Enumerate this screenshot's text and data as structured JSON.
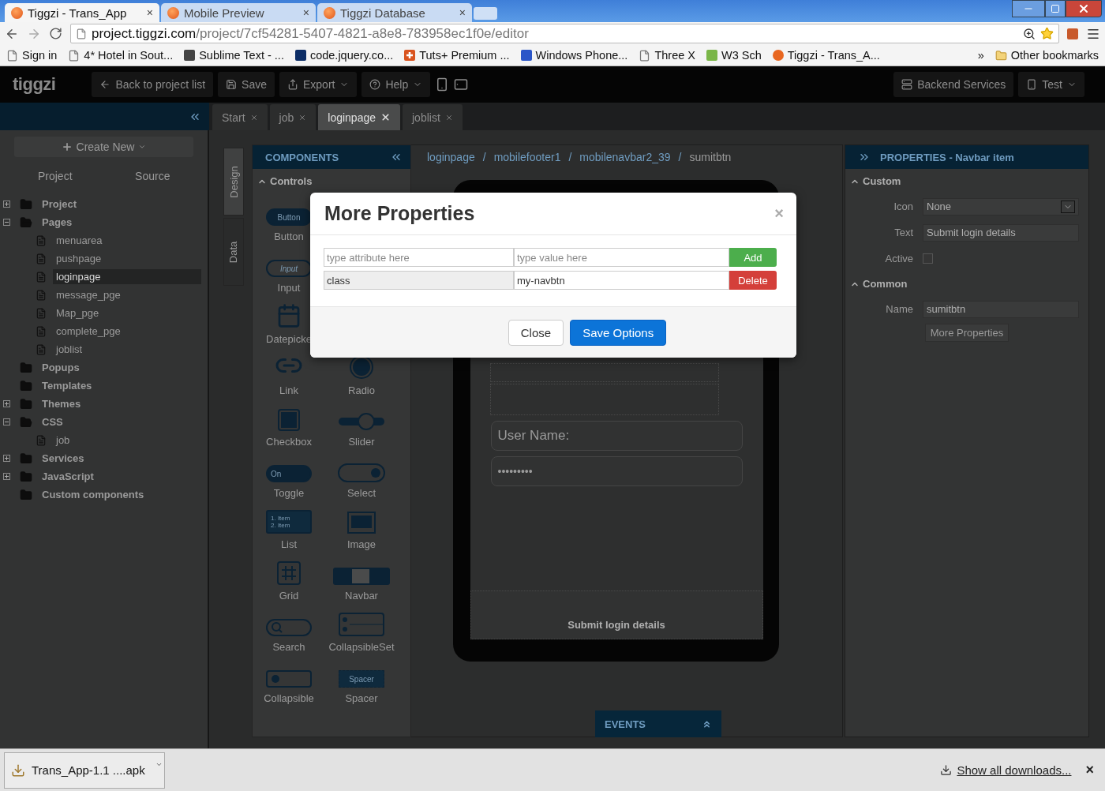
{
  "browser": {
    "tabs": [
      {
        "title": "Tiggzi - Trans_App",
        "selected": true,
        "close": "×"
      },
      {
        "title": "Mobile Preview",
        "selected": false,
        "close": "×"
      },
      {
        "title": "Tiggzi Database",
        "selected": false,
        "close": "×"
      }
    ],
    "address": {
      "host": "project.tiggzi.com",
      "path": "/project/7cf54281-5407-4821-a8e8-783958ec1f0e/editor"
    },
    "bookmarks": [
      {
        "label": "Sign in",
        "kind": "page"
      },
      {
        "label": "4* Hotel in Sout...",
        "kind": "page"
      },
      {
        "label": "Sublime Text - ...",
        "kind": "app"
      },
      {
        "label": "code.jquery.co...",
        "kind": "swirl"
      },
      {
        "label": "Tuts+ Premium ...",
        "kind": "plus"
      },
      {
        "label": "Windows Phone...",
        "kind": "letter"
      },
      {
        "label": "Three X",
        "kind": "page"
      },
      {
        "label": "W3 Sch",
        "kind": "wave"
      },
      {
        "label": "Tiggzi - Trans_A...",
        "kind": "dot"
      }
    ],
    "bookmarks_more": "»",
    "other_bookmarks": "Other bookmarks"
  },
  "toolbar": {
    "logo": "tiggzi",
    "back": "Back to project list",
    "save": "Save",
    "export": "Export",
    "help": "Help",
    "backend": "Backend Services",
    "test": "Test"
  },
  "page_tabs": [
    {
      "label": "Start",
      "selected": false
    },
    {
      "label": "job",
      "selected": false
    },
    {
      "label": "loginpage",
      "selected": true
    },
    {
      "label": "joblist",
      "selected": false
    }
  ],
  "sidebar": {
    "create": "Create New",
    "tabs": [
      {
        "label": "Project"
      },
      {
        "label": "Source"
      }
    ],
    "tree": [
      {
        "label": "Project",
        "collapsible": true,
        "expanded": false
      },
      {
        "label": "Pages",
        "collapsible": true,
        "expanded": true,
        "children": [
          {
            "label": "menuarea",
            "selected": false
          },
          {
            "label": "pushpage",
            "selected": false
          },
          {
            "label": "loginpage",
            "selected": true
          },
          {
            "label": "message_pge",
            "selected": false
          },
          {
            "label": "Map_pge",
            "selected": false
          },
          {
            "label": "complete_pge",
            "selected": false
          },
          {
            "label": "joblist",
            "selected": false
          }
        ]
      },
      {
        "label": "Popups",
        "collapsible": false,
        "expanded": false
      },
      {
        "label": "Templates",
        "collapsible": false,
        "expanded": false
      },
      {
        "label": "Themes",
        "collapsible": true,
        "expanded": false
      },
      {
        "label": "CSS",
        "collapsible": true,
        "expanded": true,
        "children": [
          {
            "label": "job",
            "selected": false
          }
        ]
      },
      {
        "label": "Services",
        "collapsible": true,
        "expanded": false
      },
      {
        "label": "JavaScript",
        "collapsible": true,
        "expanded": false
      },
      {
        "label": "Custom components",
        "collapsible": false,
        "expanded": false
      }
    ]
  },
  "side_tabs": [
    {
      "label": "Design",
      "selected": true
    },
    {
      "label": "Data",
      "selected": false
    }
  ],
  "components": {
    "title": "COMPONENTS",
    "section": "Controls",
    "rows": [
      [
        {
          "label": "Button",
          "kind": "button",
          "icon_text": "Button"
        }
      ],
      [
        {
          "label": "Input",
          "kind": "input",
          "icon_text": "Input"
        }
      ],
      [
        {
          "label": "Datepicke",
          "kind": "datepicker"
        }
      ],
      [
        {
          "label": "Link",
          "kind": "link"
        },
        {
          "label": "Radio",
          "kind": "radio"
        }
      ],
      [
        {
          "label": "Checkbox",
          "kind": "checkbox"
        },
        {
          "label": "Slider",
          "kind": "slider"
        }
      ],
      [
        {
          "label": "Toggle",
          "kind": "toggle",
          "icon_text": "On"
        },
        {
          "label": "Select",
          "kind": "select"
        }
      ],
      [
        {
          "label": "List",
          "kind": "list",
          "icon_lines": [
            "1. Item",
            "2. Item"
          ]
        },
        {
          "label": "Image",
          "kind": "image"
        }
      ],
      [
        {
          "label": "Grid",
          "kind": "grid"
        },
        {
          "label": "Navbar",
          "kind": "navbar"
        }
      ],
      [
        {
          "label": "Search",
          "kind": "search"
        },
        {
          "label": "CollapsibleSet",
          "kind": "collapsibleset"
        }
      ],
      [
        {
          "label": "Collapsible",
          "kind": "collapsible"
        },
        {
          "label": "Spacer",
          "kind": "spacer",
          "icon_text": "Spacer"
        }
      ]
    ]
  },
  "breadcrumb": {
    "separator": "/",
    "items": [
      "loginpage",
      "mobilefooter1",
      "mobilenavbar2_39",
      "sumitbtn"
    ]
  },
  "phone": {
    "username": "User Name:",
    "password": "•••••••••",
    "footer": "Submit login details"
  },
  "events": "EVENTS",
  "properties": {
    "title": "PROPERTIES - Navbar item",
    "sections": [
      {
        "title": "Custom",
        "rows": [
          {
            "label": "Icon",
            "kind": "select",
            "value": "None"
          },
          {
            "label": "Text",
            "kind": "text",
            "value": "Submit login details"
          },
          {
            "label": "Active",
            "kind": "checkbox",
            "checked": false
          }
        ]
      },
      {
        "title": "Common",
        "rows": [
          {
            "label": "Name",
            "kind": "text",
            "value": "sumitbtn"
          }
        ]
      }
    ],
    "more": "More Properties"
  },
  "modal": {
    "title": "More Properties",
    "close": "×",
    "new_row": {
      "attribute_placeholder": "type attribute here",
      "value_placeholder": "type value here",
      "action": "Add"
    },
    "rows": [
      {
        "attribute": "class",
        "value": "my-navbtn",
        "action": "Delete"
      }
    ],
    "buttons": [
      {
        "label": "Close",
        "kind": "default"
      },
      {
        "label": "Save Options",
        "kind": "primary"
      }
    ]
  },
  "downloads": {
    "file": "Trans_App-1.1 ....apk",
    "show_all": "Show all downloads...",
    "close": "×"
  }
}
